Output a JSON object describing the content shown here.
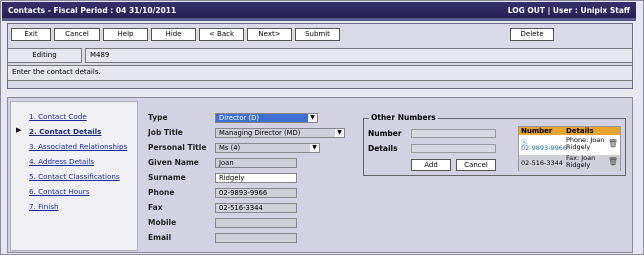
{
  "titlebar": {
    "left": "Contacts - Fiscal Period : 04 31/10/2011",
    "logout": "LOG OUT",
    "user": "| User : Unipix Staff"
  },
  "toolbar": {
    "buttons": [
      "Exit",
      "Cancel",
      "Help",
      "Hide",
      "< Back",
      "Next>",
      "Submit"
    ],
    "delete": "Delete"
  },
  "status": {
    "mode_label": "Editing",
    "record": "M489",
    "message": "Enter the contact details."
  },
  "steps": [
    {
      "label": "1. Contact Code",
      "active": false
    },
    {
      "label": "2. Contact Details",
      "active": true
    },
    {
      "label": "3. Associated Relationships",
      "active": false
    },
    {
      "label": "4. Address Details",
      "active": false
    },
    {
      "label": "5. Contact Classifications",
      "active": false
    },
    {
      "label": "6. Contact Hours",
      "active": false
    },
    {
      "label": "7. Finish",
      "active": false
    }
  ],
  "form": {
    "type_label": "Type",
    "type_value": "Director (D)",
    "job_title_label": "Job Title",
    "job_title_value": "Managing Director (MD)",
    "personal_title_label": "Personal Title",
    "personal_title_value": "Ms (4)",
    "given_name_label": "Given Name",
    "given_name_value": "Joan",
    "surname_label": "Surname",
    "surname_value": "Ridgely",
    "phone_label": "Phone",
    "phone_value": "02-9893-9966",
    "fax_label": "Fax",
    "fax_value": "02-516-3344",
    "mobile_label": "Mobile",
    "mobile_value": "",
    "email_label": "Email",
    "email_value": ""
  },
  "other_numbers": {
    "legend": "Other Numbers",
    "number_label": "Number",
    "details_label": "Details",
    "add": "Add",
    "cancel": "Cancel",
    "col_number": "Number",
    "col_details": "Details",
    "rows": [
      {
        "number": "02-9893-9966",
        "details": "Phone: Joan Ridgely"
      },
      {
        "number": "02-516-3344",
        "details": "Fax: Joan Ridgely"
      }
    ]
  },
  "colors": {
    "titlebar": "#2b2760",
    "table_header": "#e6a530",
    "link": "#1a2a9a"
  }
}
